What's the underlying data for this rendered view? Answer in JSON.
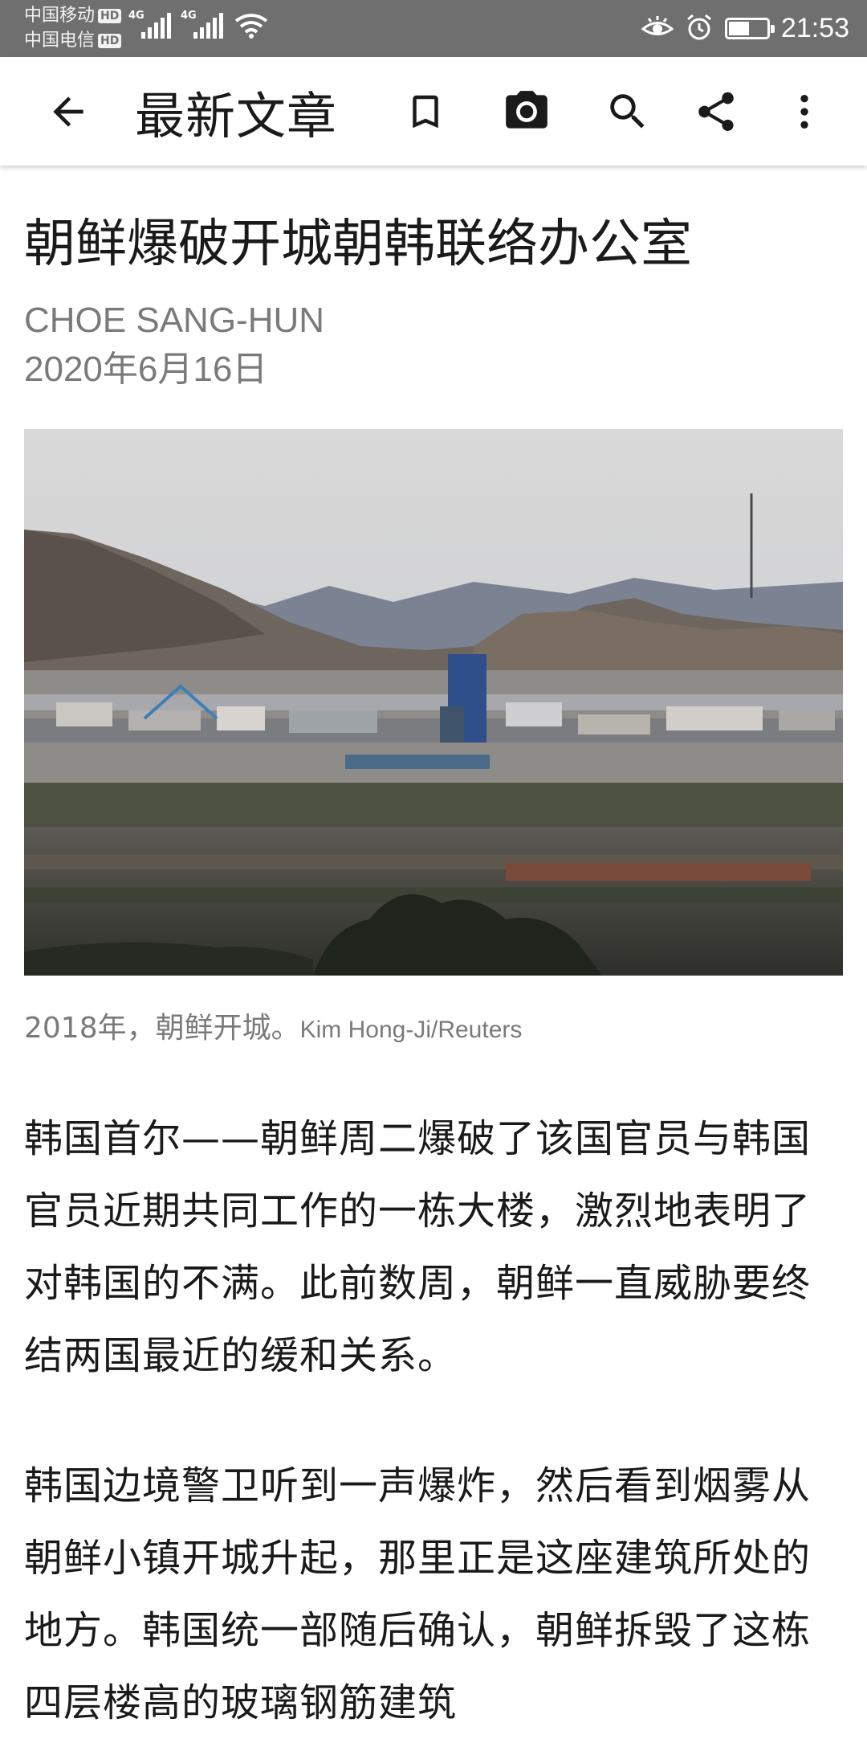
{
  "status_bar": {
    "carrier_1": "中国移动",
    "carrier_2": "中国电信",
    "hd_badge": "HD",
    "network_type": "4G",
    "time": "21:53",
    "battery_level": 0.5
  },
  "app_bar": {
    "title": "最新文章",
    "icons": [
      "back-arrow-icon",
      "bookmark-icon",
      "camera-icon",
      "search-icon",
      "share-icon",
      "more-vert-icon"
    ]
  },
  "article": {
    "headline": "朝鲜爆破开城朝韩联络办公室",
    "author": "CHOE SANG-HUN",
    "date": "2020年6月16日",
    "image_caption": "2018年，朝鲜开城。",
    "image_credit": "Kim Hong-Ji/Reuters",
    "paragraphs": [
      "韩国首尔——朝鲜周二爆破了该国官员与韩国官员近期共同工作的一栋大楼，激烈地表明了对韩国的不满。此前数周，朝鲜一直威胁要终结两国最近的缓和关系。",
      "韩国边境警卫听到一声爆炸，然后看到烟雾从朝鲜小镇开城升起，那里正是这座建筑所处的地方。韩国统一部随后确认，朝鲜拆毁了这栋四层楼高的玻璃钢筋建筑"
    ]
  },
  "colors": {
    "status_bar_bg": "#6f6f6f",
    "text_primary": "#1a1a1a",
    "text_secondary": "#7a7a7a"
  }
}
